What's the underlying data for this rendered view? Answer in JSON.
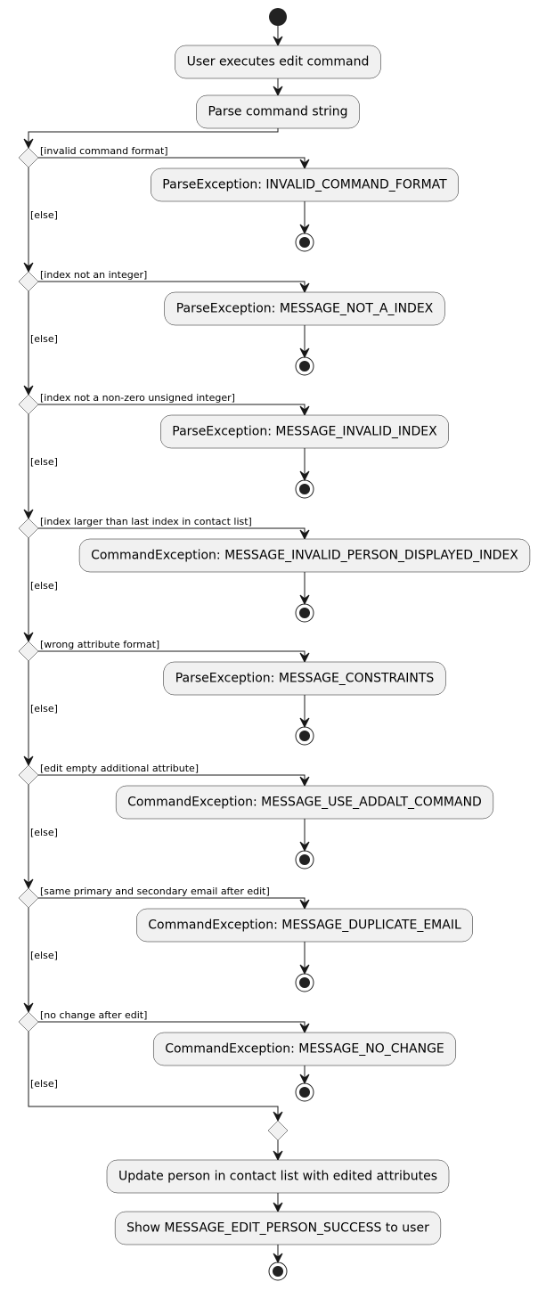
{
  "diagram": {
    "type": "activity",
    "start_actions": [
      "User executes edit command",
      "Parse command string"
    ],
    "decisions": [
      {
        "guard": "[invalid command format]",
        "action": "ParseException: INVALID_COMMAND_FORMAT",
        "else_label": "[else]"
      },
      {
        "guard": "[index not an integer]",
        "action": "ParseException: MESSAGE_NOT_A_INDEX",
        "else_label": "[else]"
      },
      {
        "guard": "[index not a non-zero unsigned integer]",
        "action": "ParseException: MESSAGE_INVALID_INDEX",
        "else_label": "[else]"
      },
      {
        "guard": "[index larger than last index in contact list]",
        "action": "CommandException: MESSAGE_INVALID_PERSON_DISPLAYED_INDEX",
        "else_label": "[else]"
      },
      {
        "guard": "[wrong attribute format]",
        "action": "ParseException: MESSAGE_CONSTRAINTS",
        "else_label": "[else]"
      },
      {
        "guard": "[edit empty additional attribute]",
        "action": "CommandException: MESSAGE_USE_ADDALT_COMMAND",
        "else_label": "[else]"
      },
      {
        "guard": "[same primary and secondary email after edit]",
        "action": "CommandException: MESSAGE_DUPLICATE_EMAIL",
        "else_label": "[else]"
      },
      {
        "guard": "[no change after edit]",
        "action": "CommandException: MESSAGE_NO_CHANGE",
        "else_label": "[else]"
      }
    ],
    "end_actions": [
      "Update person in contact list with edited attributes",
      "Show MESSAGE_EDIT_PERSON_SUCCESS to user"
    ],
    "colors": {
      "node_fill": "#f1f1f1",
      "stroke": "#181818",
      "start_end_fill": "#222222"
    }
  }
}
